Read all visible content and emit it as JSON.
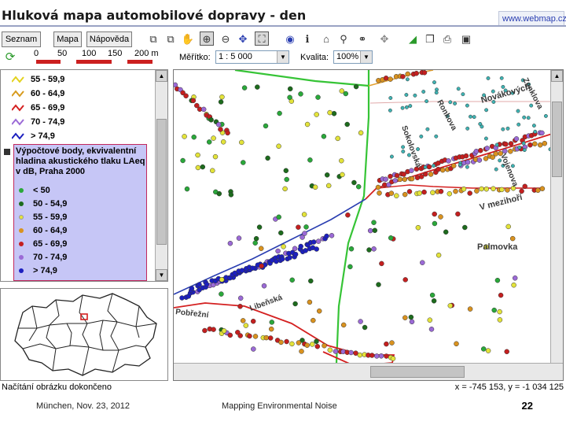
{
  "header": {
    "title": "Hluková mapa automobilové dopravy - den",
    "site_link": "www.webmap.cz"
  },
  "toolbar": {
    "seznam": "Seznam",
    "mapa": "Mapa",
    "napoveda": "Nápověda"
  },
  "scale": {
    "ticks": [
      "0",
      "50",
      "100",
      "150",
      "200 m"
    ],
    "meritko_label": "Měřítko:",
    "meritko_value": "1 : 5 000",
    "kvalita_label": "Kvalita:",
    "kvalita_value": "100%"
  },
  "legend": {
    "lines": [
      {
        "label": "55 - 59,9",
        "color": "#e3d21d"
      },
      {
        "label": "60 - 64,9",
        "color": "#d79a1c"
      },
      {
        "label": "65 - 69,9",
        "color": "#d42020"
      },
      {
        "label": "70 - 74,9",
        "color": "#9b6ad6"
      },
      {
        "label": "> 74,9",
        "color": "#1c1fbf"
      }
    ],
    "points_heading": "Výpočtové body, ekvivalentní hladina akustického tlaku LAeq v dB, Praha 2000",
    "points": [
      {
        "label": "< 50",
        "color": "#2aa83a"
      },
      {
        "label": "50 - 54,9",
        "color": "#1d6b1d"
      },
      {
        "label": "55 - 59,9",
        "color": "#e3e33a"
      },
      {
        "label": "60 - 64,9",
        "color": "#d9921f"
      },
      {
        "label": "65 - 69,9",
        "color": "#c41f1f"
      },
      {
        "label": "70 - 74,9",
        "color": "#9b6ad6"
      },
      {
        "label": "> 74,9",
        "color": "#1c1fbf"
      }
    ]
  },
  "map": {
    "labels": {
      "street1": "Novákových",
      "street2": "Ronkova",
      "street3": "Sokolovská",
      "street4": "Palmovka",
      "street5": "V mezihoří",
      "street6": "Zenklova",
      "street7": "Vojenova",
      "street8": "Libeňská",
      "street9": "Vrbenského",
      "street10": "Na Žertvách",
      "street11": "Pobřežní"
    }
  },
  "status": {
    "left": "Načítání obrázku dokončeno",
    "coords": "x = -745 153, y = -1 034 125"
  },
  "footer": {
    "left": "München, Nov. 23, 2012",
    "center": "Mapping Environmental Noise",
    "page": "22"
  },
  "colors": {
    "accent": "#2a3eb1",
    "legend_points_bg": "#c6c6f6",
    "legend_points_border": "#c2285c"
  }
}
